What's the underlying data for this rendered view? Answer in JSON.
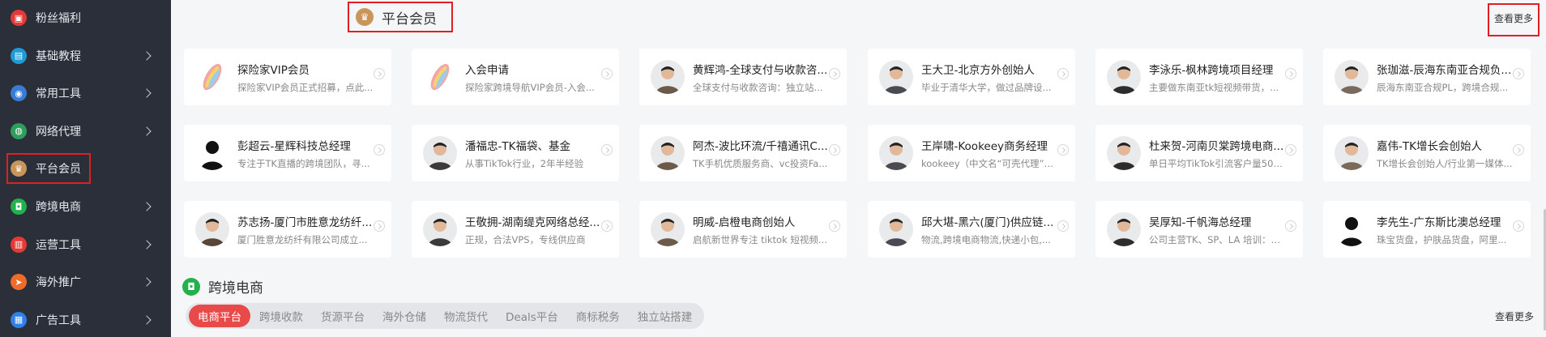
{
  "sidebar": {
    "items": [
      {
        "label": "粉丝福利",
        "icon": "gift-icon",
        "color": "#e53935",
        "chevron": false
      },
      {
        "label": "基础教程",
        "icon": "book-icon",
        "color": "#1e9bd7",
        "chevron": true
      },
      {
        "label": "常用工具",
        "icon": "chrome-icon",
        "color": "#3a7bd5",
        "chevron": true
      },
      {
        "label": "网络代理",
        "icon": "globe-icon",
        "color": "#2e9e5b",
        "chevron": true
      },
      {
        "label": "平台会员",
        "icon": "crown-icon",
        "color": "#c8965a",
        "chevron": false
      },
      {
        "label": "跨境电商",
        "icon": "shopping-bag-icon",
        "color": "#22b14c",
        "chevron": true
      },
      {
        "label": "运营工具",
        "icon": "toolbox-icon",
        "color": "#e53935",
        "chevron": true
      },
      {
        "label": "海外推广",
        "icon": "paper-plane-icon",
        "color": "#f06b2a",
        "chevron": true
      },
      {
        "label": "广告工具",
        "icon": "ad-icon",
        "color": "#2f80ed",
        "chevron": true
      }
    ]
  },
  "sections": {
    "membership": {
      "title": "平台会员",
      "more": "查看更多",
      "icon_color": "#c8965a"
    },
    "crossborder": {
      "title": "跨境电商",
      "more": "查看更多",
      "icon_color": "#22b14c"
    }
  },
  "cards": [
    {
      "title": "探险家VIP会员",
      "desc": "探险家VIP会员正式招募，点此...",
      "avatar": "surfboard-logo"
    },
    {
      "title": "入会申请",
      "desc": "探险家跨境导航VIP会员-入会...",
      "avatar": "surfboard-logo"
    },
    {
      "title": "黄辉鸿-全球支付与收款咨...",
      "desc": "全球支付与收款咨询：独立站...",
      "avatar": "person-photo"
    },
    {
      "title": "王大卫-北京方外创始人",
      "desc": "毕业于清华大学，做过品牌设...",
      "avatar": "person-photo"
    },
    {
      "title": "李泳乐-枫林跨境项目经理",
      "desc": "主要做东南亚tk短视频带货，...",
      "avatar": "person-photo"
    },
    {
      "title": "张珈滋-辰海东南亚合规负...",
      "desc": "辰海东南亚合规PL，跨境合规...",
      "avatar": "person-photo"
    },
    {
      "title": "彭超云-星辉科技总经理",
      "desc": "专注于TK直播的跨境团队，寻...",
      "avatar": "silhouette"
    },
    {
      "title": "潘福忠-TK福袋、基金",
      "desc": "从事TikTok行业，2年半经验",
      "avatar": "person-photo"
    },
    {
      "title": "阿杰-波比环流/千禧通讯C...",
      "desc": "TK手机优质服务商、vc投资Fa...",
      "avatar": "person-photo"
    },
    {
      "title": "王岸啸-Kookeey商务经理",
      "desc": "kookeey（中文名“可壳代理”）...",
      "avatar": "person-photo"
    },
    {
      "title": "杜来贺-河南贝棠跨境电商...",
      "desc": "单日平均TikTok引流客户量500...",
      "avatar": "person-photo"
    },
    {
      "title": "嘉伟-TK增长会创始人",
      "desc": "TK增长会创始人/行业第一媒体...",
      "avatar": "person-photo"
    },
    {
      "title": "苏志扬-厦门市胜意龙纺纤...",
      "desc": "厦门胜意龙纺纤有限公司成立...",
      "avatar": "person-photo"
    },
    {
      "title": "王敬拥-湖南缇克网络总经...",
      "desc": "正规，合法VPS，专线供应商",
      "avatar": "person-photo"
    },
    {
      "title": "明威-启橙电商创始人",
      "desc": "启航新世界专注 tiktok 短视频...",
      "avatar": "person-photo"
    },
    {
      "title": "邱大堪-黑六(厦门)供应链...",
      "desc": "物流,跨境电商物流,快递小包,...",
      "avatar": "person-photo"
    },
    {
      "title": "吴厚知-千帆海总经理",
      "desc": "公司主营TK、SP、LA 培训：自...",
      "avatar": "person-photo"
    },
    {
      "title": "李先生-广东斯比澳总经理",
      "desc": "珠宝货盘，护肤品货盘，阿里...",
      "avatar": "silhouette"
    }
  ],
  "tabs": [
    "电商平台",
    "跨境收款",
    "货源平台",
    "海外仓储",
    "物流货代",
    "Deals平台",
    "商标税务",
    "独立站搭建"
  ]
}
